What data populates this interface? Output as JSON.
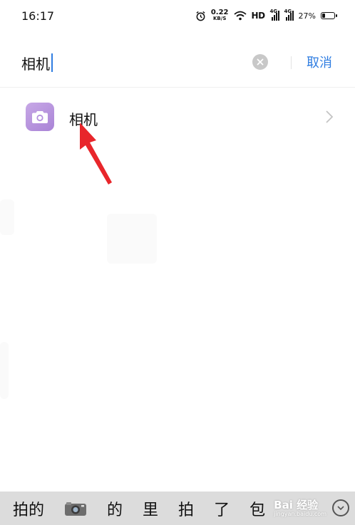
{
  "status_bar": {
    "time": "16:17",
    "net_speed_value": "0.22",
    "net_speed_unit": "KB/S",
    "hd_label": "HD",
    "signal1_label": "4G",
    "signal2_label": "4G",
    "battery_percent": "27%",
    "battery_level": 0.27
  },
  "search": {
    "query": "相机",
    "cancel_label": "取消"
  },
  "results": [
    {
      "label": "相机",
      "icon": "camera-icon",
      "icon_color": "#b592de"
    }
  ],
  "keyboard": {
    "candidates": [
      "拍的",
      "📷",
      "的",
      "里",
      "拍",
      "了",
      "包"
    ],
    "watermark_title": "Bai 经验",
    "watermark_sub": "jingyan.baidu.com"
  },
  "colors": {
    "accent": "#2f7de1",
    "annotation_arrow": "#e8262b"
  }
}
